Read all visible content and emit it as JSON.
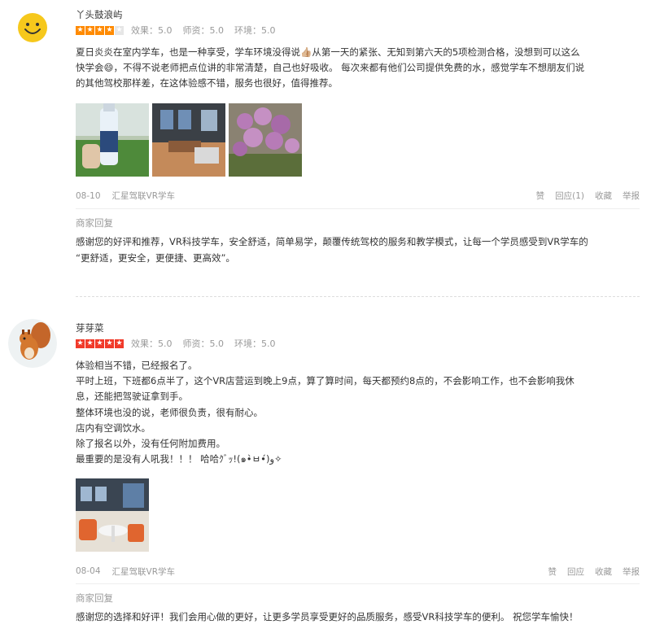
{
  "reviews": [
    {
      "username": "丫头鼓浪屿",
      "rating": 4,
      "score_items": [
        "效果：5.0",
        "师资：5.0",
        "环境：5.0"
      ],
      "content_lines": [
        "夏日炎炎在室内学车，也是一种享受，学车环境没得说👍🏼从第一天的紧张、无知到第六天的5项检测合格，没想到可以这么",
        "快学会😄，不得不说老师把点位讲的非常清楚，自己也好吸收。 每次来都有他们公司提供免费的水，感觉学车不想朋友们说",
        "的其他驾校那样差，在这体验感不错，服务也很好，值得推荐。"
      ],
      "date": "08-10",
      "store": "汇星驾联VR学车",
      "actions": {
        "like": "赞",
        "reply": "回应(1)",
        "favorite": "收藏",
        "report": "举报"
      },
      "merchant_reply_title": "商家回复",
      "merchant_reply_lines": [
        "感谢您的好评和推荐，VR科技学车，安全舒适，简单易学，颠覆传统驾校的服务和教学模式，让每一个学员感受到VR学车的",
        "“更舒适，更安全，更便捷、更高效”。"
      ]
    },
    {
      "username": "芽芽菜",
      "rating": 5,
      "score_items": [
        "效果：5.0",
        "师资：5.0",
        "环境：5.0"
      ],
      "content_lines": [
        "体验相当不错，已经报名了。",
        "平时上班，下班都6点半了，这个VR店营运到晚上9点，算了算时间，每天都预约8点的，不会影响工作，也不会影响我休",
        "息，还能把驾驶证拿到手。",
        "整体环境也没的说，老师很负责，很有耐心。",
        "店内有空调饮水。",
        "除了报名以外，没有任何附加费用。",
        "最重要的是没有人吼我！！！ 哈哈ｸﾞｯ!(๑•̀ㅂ•́)و✧"
      ],
      "date": "08-04",
      "store": "汇星驾联VR学车",
      "actions": {
        "like": "赞",
        "reply": "回应",
        "favorite": "收藏",
        "report": "举报"
      },
      "merchant_reply_title": "商家回复",
      "merchant_reply_lines": [
        "感谢您的选择和好评！我们会用心做的更好，让更多学员享受更好的品质服务，感受VR科技学车的便利。 祝您学车愉快！"
      ]
    }
  ]
}
